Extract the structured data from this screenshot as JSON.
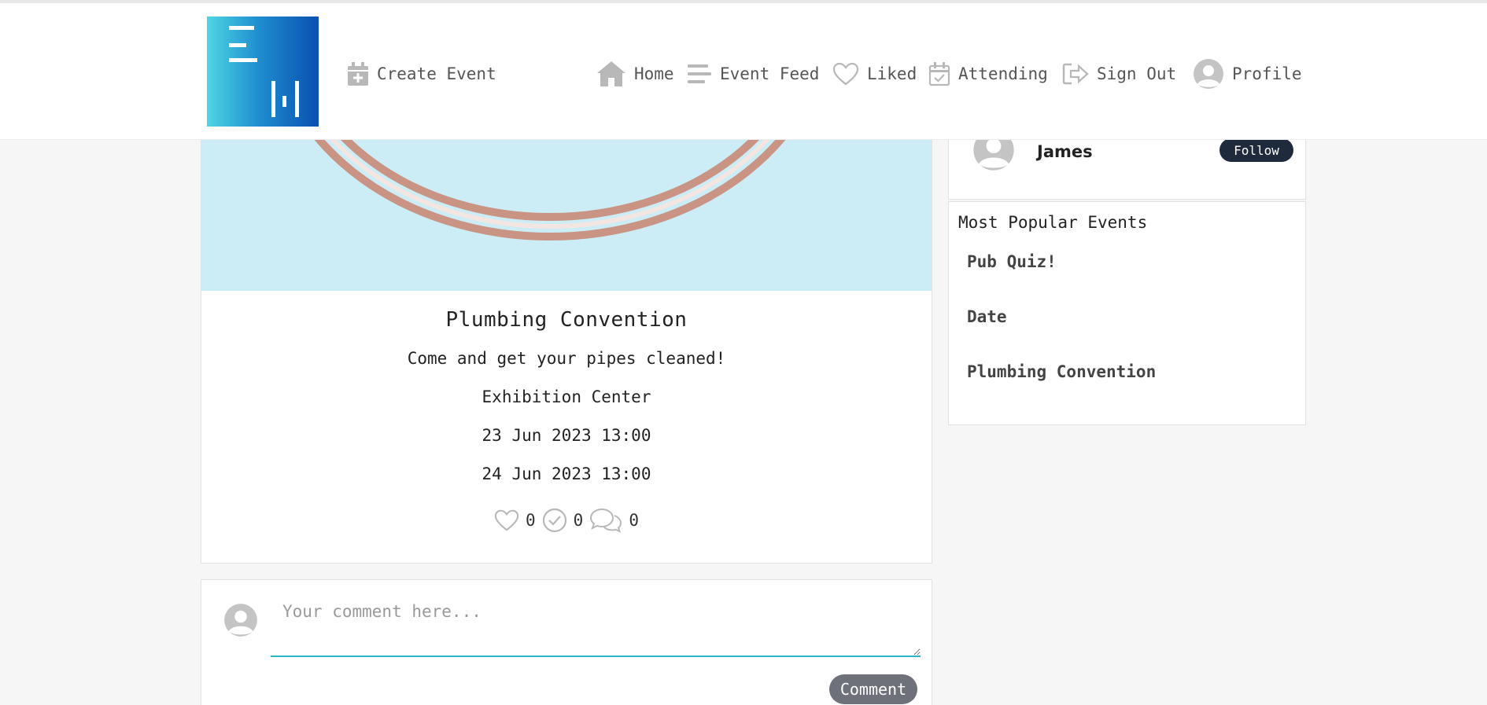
{
  "nav": {
    "create_event": "Create Event",
    "home": "Home",
    "event_feed": "Event Feed",
    "liked": "Liked",
    "attending": "Attending",
    "sign_out": "Sign Out",
    "profile": "Profile"
  },
  "event": {
    "title": "Plumbing Convention",
    "description": "Come and get your pipes cleaned!",
    "location": "Exhibition Center",
    "start": "23 Jun 2023 13:00",
    "end": "24 Jun 2023 13:00",
    "likes": "0",
    "attending": "0",
    "comments": "0"
  },
  "comment_box": {
    "placeholder": "Your comment here...",
    "submit_label": "Comment"
  },
  "organizer": {
    "name": "James",
    "follow_label": "Follow"
  },
  "popular": {
    "heading": "Most Popular Events",
    "items": [
      "Pub Quiz!",
      "Date",
      "Plumbing Convention"
    ]
  },
  "colors": {
    "accent": "#2bb3c7",
    "follow_button": "#1f2a3c",
    "comment_button": "#6f717a",
    "image_background": "#ccedf5"
  }
}
